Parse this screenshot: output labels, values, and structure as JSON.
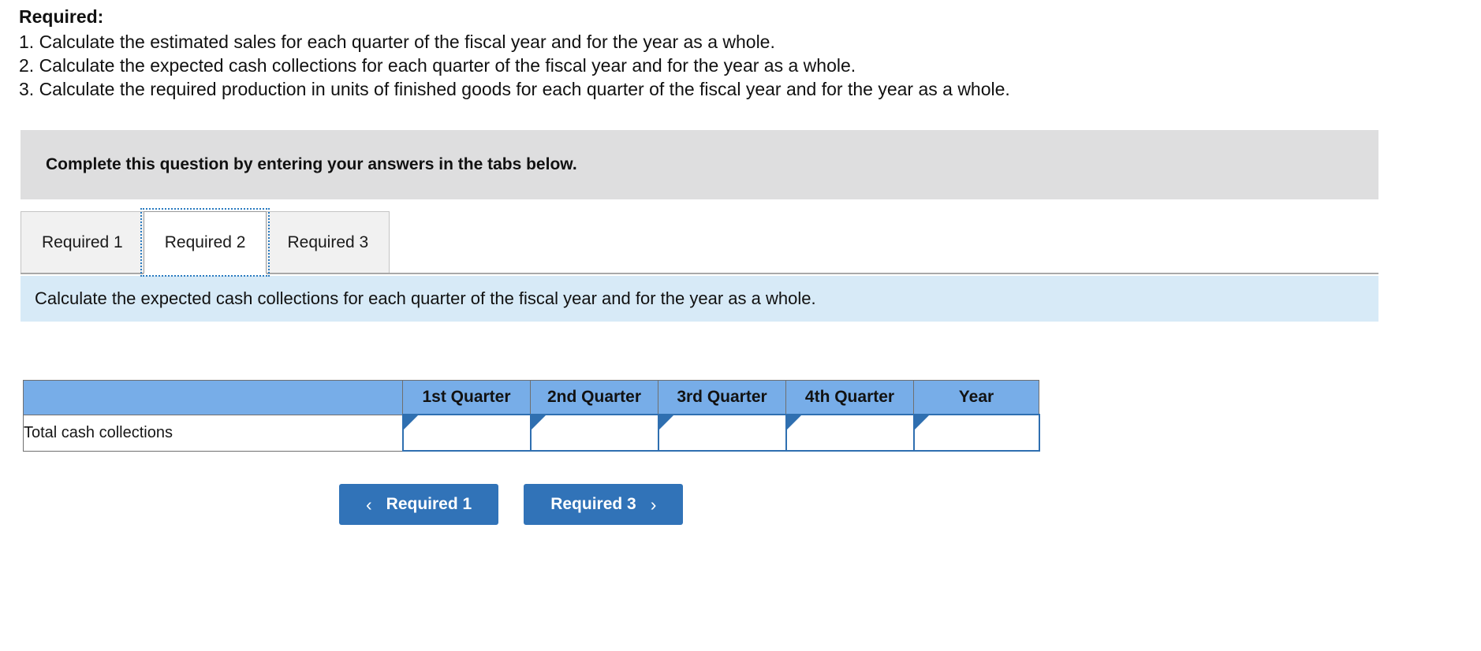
{
  "requirements": {
    "heading": "Required:",
    "items": [
      "1. Calculate the estimated sales for each quarter of the fiscal year and for the year as a whole.",
      "2. Calculate the expected cash collections for each quarter of the fiscal year and for the year as a whole.",
      "3. Calculate the required production in units of finished goods for each quarter of the fiscal year and for the year as a whole."
    ]
  },
  "banner": {
    "text": "Complete this question by entering your answers in the tabs below."
  },
  "tabs": {
    "items": [
      {
        "label": "Required 1",
        "active": false
      },
      {
        "label": "Required 2",
        "active": true
      },
      {
        "label": "Required 3",
        "active": false
      }
    ]
  },
  "instruction": {
    "text": "Calculate the expected cash collections for each quarter of the fiscal year and for the year as a whole."
  },
  "table": {
    "headers": [
      "",
      "1st Quarter",
      "2nd Quarter",
      "3rd Quarter",
      "4th Quarter",
      "Year"
    ],
    "rows": [
      {
        "label": "Total cash collections",
        "values": [
          "",
          "",
          "",
          "",
          ""
        ]
      }
    ]
  },
  "nav": {
    "prev": {
      "label": "Required 1",
      "icon": "chevron-left-icon",
      "glyph": "‹"
    },
    "next": {
      "label": "Required 3",
      "icon": "chevron-right-icon",
      "glyph": "›"
    }
  },
  "colors": {
    "banner_bg": "#dededf",
    "instruction_bg": "#d7eaf7",
    "table_header_bg": "#77ade8",
    "input_border": "#2f6fb0",
    "button_bg": "#3173b8",
    "focus_outline": "#2a7bc0"
  }
}
